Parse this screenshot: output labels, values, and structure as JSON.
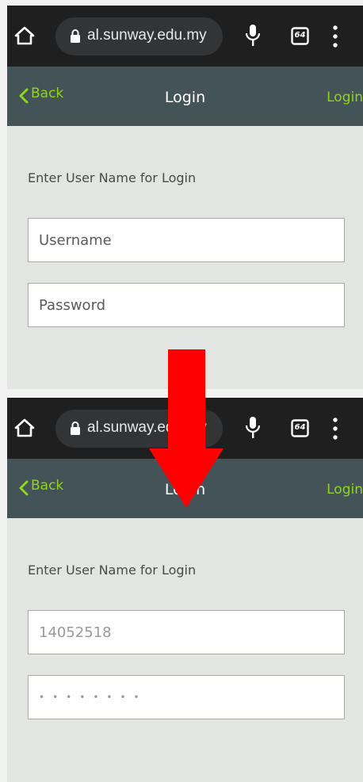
{
  "colors": {
    "chrome_bg": "#1f1f1f",
    "url_pill": "#333436",
    "nav_bg": "#445358",
    "accent_green": "#8fd619",
    "content_bg": "#e2e5e1",
    "arrow_red": "#ff0000"
  },
  "icons": {
    "home": "home-icon",
    "lock": "lock-icon",
    "mic": "mic-icon",
    "tabs": "tab-switcher-icon",
    "menu": "menu-dots-icon",
    "back": "chevron-left-icon",
    "annotation": "red-down-arrow"
  },
  "before": {
    "browser": {
      "url": "al.sunway.edu.my",
      "tab_count": "64"
    },
    "nav": {
      "back_label": "Back",
      "title": "Login",
      "action_label": "Login"
    },
    "form": {
      "prompt": "Enter User Name for Login",
      "username_placeholder": "Username",
      "password_placeholder": "Password",
      "username_value": "",
      "password_value": ""
    }
  },
  "after": {
    "browser": {
      "url": "al.sunway.edu.my",
      "tab_count": "64"
    },
    "nav": {
      "back_label": "Back",
      "title": "Login",
      "action_label": "Login"
    },
    "form": {
      "prompt": "Enter User Name for Login",
      "username_value": "14052518",
      "password_value": "••••••••"
    }
  }
}
